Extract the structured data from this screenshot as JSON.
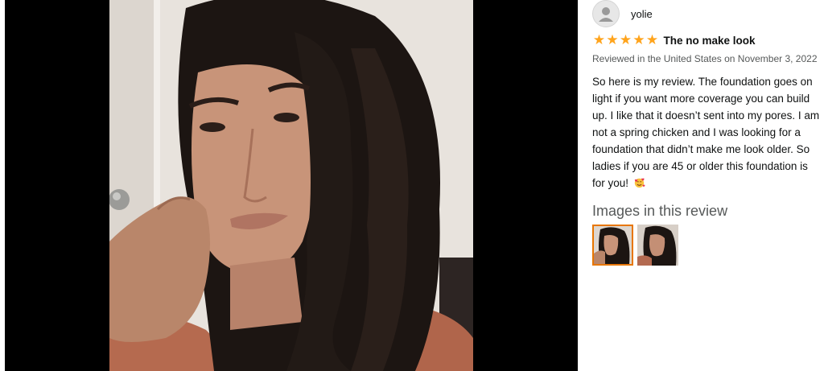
{
  "review": {
    "author": "yolie",
    "rating": 5,
    "rating_max": 5,
    "title": "The no make look",
    "date": "Reviewed in the United States on November 3, 2022",
    "body": "So here is my review. The foundation goes on light if you want more coverage you can build up. I like that it doesn’t sent into my pores. I am not a spring chicken and I was looking for a foundation that didn’t make me look older. So ladies if you are 45 or older this foundation is for you!",
    "emoji": "smiling-face-with-hearts"
  },
  "images_section": {
    "heading": "Images in this review",
    "thumbnails": [
      {
        "selected": true
      },
      {
        "selected": false
      }
    ]
  },
  "colors": {
    "star": "#ffa41c",
    "selected_border": "#e77600",
    "viewer_background": "#000000"
  }
}
